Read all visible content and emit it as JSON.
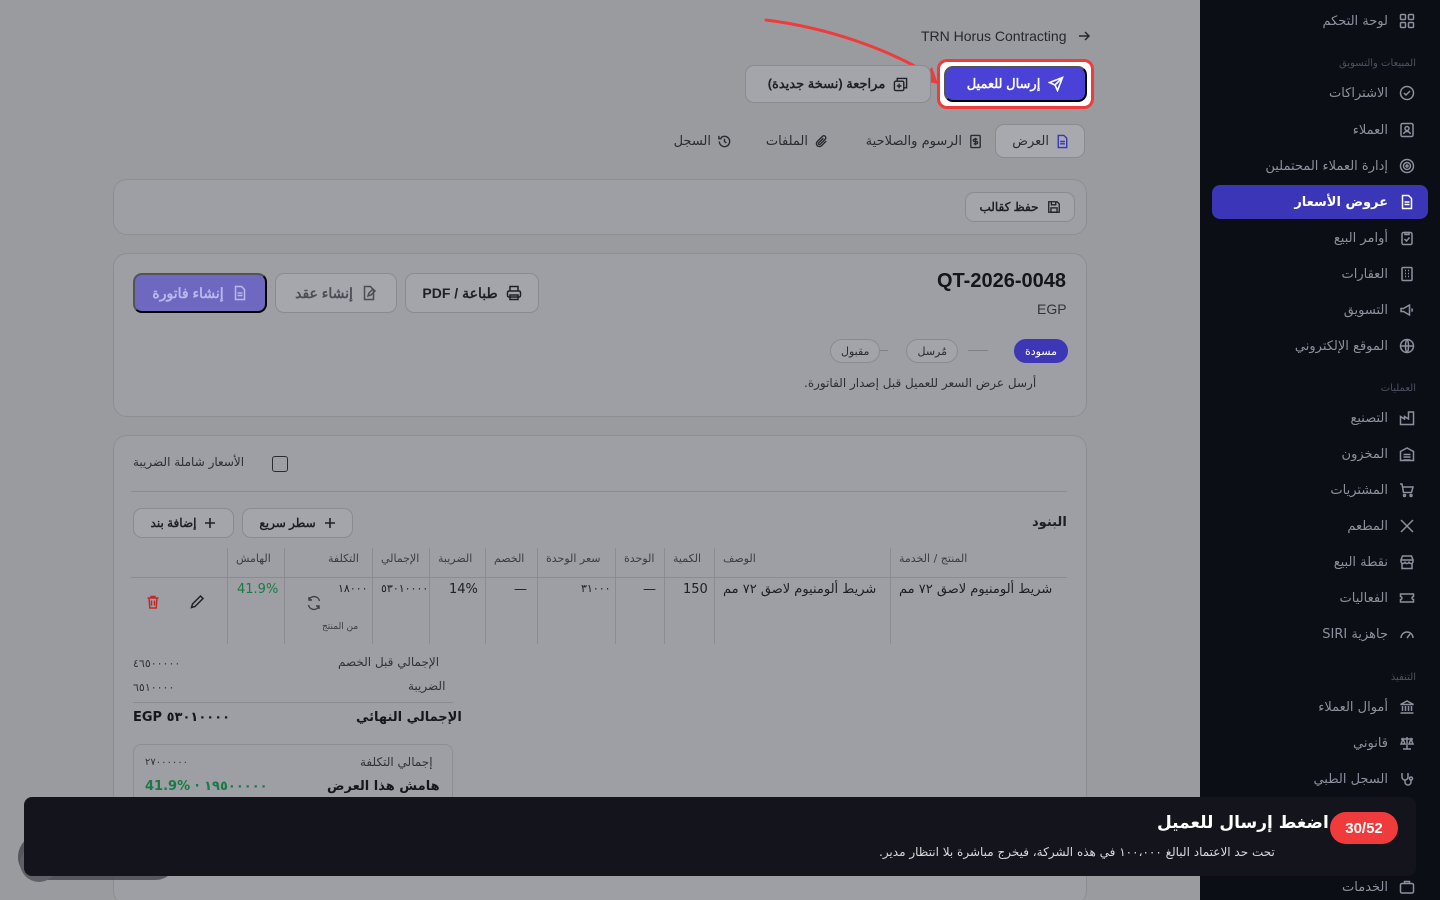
{
  "breadcrumb": {
    "company": "TRN Horus Contracting"
  },
  "header_actions": {
    "send_to_client": "إرسال للعميل",
    "revise_new_version": "مراجعة (نسخة جديدة)"
  },
  "tabs": [
    {
      "label": "العرض",
      "icon": "document-icon"
    },
    {
      "label": "الرسوم والصلاحية",
      "icon": "receipt-icon"
    },
    {
      "label": "الملفات",
      "icon": "paperclip-icon"
    },
    {
      "label": "السجل",
      "icon": "history-icon"
    }
  ],
  "template": {
    "save_as_template": "حفظ كقالب"
  },
  "quote": {
    "id": "QT-2026-0048",
    "currency": "EGP",
    "print_pdf": "طباعة / PDF",
    "create_contract": "إنشاء عقد",
    "create_invoice": "إنشاء فاتورة",
    "statuses": [
      "مسودة",
      "مُرسل",
      "مقبول"
    ],
    "hint": "أرسل عرض السعر للعميل قبل إصدار الفاتورة."
  },
  "items": {
    "tax_inclusive_label": "الأسعار شاملة الضريبة",
    "section_title": "البنود",
    "quick_line": "سطر سريع",
    "add_item": "إضافة بند",
    "columns": [
      "المنتج / الخدمة",
      "الوصف",
      "الكمية",
      "الوحدة",
      "سعر الوحدة",
      "الخصم",
      "الضريبة",
      "الإجمالي",
      "التكلفة",
      "الهامش"
    ],
    "rows": [
      {
        "product": "شريط ألومنيوم لاصق ٧٢ مم",
        "description": "شريط ألومنيوم لاصق ٧٢ مم",
        "qty": "150",
        "unit": "—",
        "unit_price": "٣١٠٠٠",
        "discount": "—",
        "tax": "14%",
        "total": "٥٣٠١٠٠٠٠",
        "cost": "١٨٠٠٠",
        "cost_source": "من المنتج",
        "margin": "41.9%"
      }
    ]
  },
  "totals": {
    "subtotal_label": "الإجمالي قبل الخصم",
    "subtotal_value": "٤٦٥٠٠٠٠٠",
    "tax_label": "الضريبة",
    "tax_value": "٦٥١٠٠٠٠",
    "grand_label": "الإجمالي النهائي",
    "grand_value": "EGP ٥٣٠١٠٠٠٠",
    "total_cost_label": "إجمالي التكلفة",
    "total_cost_value": "٢٧٠٠٠٠٠٠",
    "margin_label": "هامش هذا العرض",
    "margin_value": "41.9% · ١٩٥٠٠٠٠٠"
  },
  "sidebar": {
    "dashboard": "لوحة التحكم",
    "sections": {
      "sales": "المبيعات والتسويق",
      "operations": "العمليات",
      "execution": "التنفيذ"
    },
    "items": [
      {
        "label": "الاشتراكات",
        "icon": "check-circle-icon"
      },
      {
        "label": "العملاء",
        "icon": "contact-icon"
      },
      {
        "label": "إدارة العملاء المحتملين",
        "icon": "target-icon"
      },
      {
        "label": "عروض الأسعار",
        "icon": "document-icon"
      },
      {
        "label": "أوامر البيع",
        "icon": "clipboard-icon"
      },
      {
        "label": "العقارات",
        "icon": "building-icon"
      },
      {
        "label": "التسويق",
        "icon": "megaphone-icon"
      },
      {
        "label": "الموقع الإلكتروني",
        "icon": "globe-icon"
      },
      {
        "label": "التصنيع",
        "icon": "factory-icon"
      },
      {
        "label": "المخزون",
        "icon": "warehouse-icon"
      },
      {
        "label": "المشتريات",
        "icon": "cart-icon"
      },
      {
        "label": "المطعم",
        "icon": "utensils-icon"
      },
      {
        "label": "نقطة البيع",
        "icon": "store-icon"
      },
      {
        "label": "الفعاليات",
        "icon": "ticket-icon"
      },
      {
        "label": "جاهزية SIRI",
        "icon": "gauge-icon"
      },
      {
        "label": "أموال العملاء",
        "icon": "bank-icon"
      },
      {
        "label": "قانوني",
        "icon": "scale-icon"
      },
      {
        "label": "السجل الطبي",
        "icon": "stethoscope-icon"
      },
      {
        "label": "الخدمات",
        "icon": "briefcase-icon"
      }
    ]
  },
  "tour": {
    "progress": "30/52",
    "title": "اضغط إرسال للعميل",
    "body": "تحت حد الاعتماد البالغ ١٠٠،٠٠٠ في هذه الشركة، فيخرج مباشرة بلا انتظار مدير."
  },
  "colors": {
    "primary": "#4a41d6",
    "highlight": "#ef3b3b",
    "margin_green": "#1a7a45",
    "sidebar_bg": "#0c0e16"
  }
}
